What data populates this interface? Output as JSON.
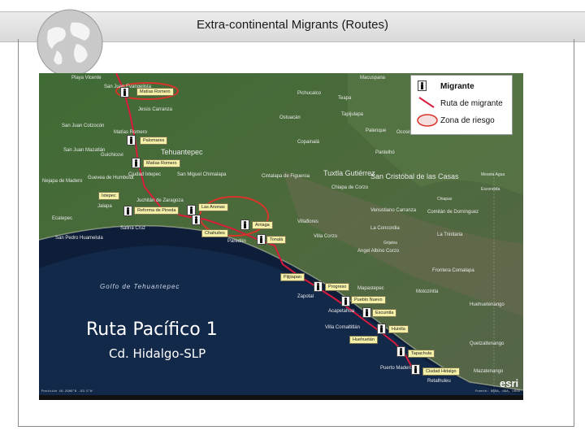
{
  "slide": {
    "title": "Extra-continental Migrants (Routes)"
  },
  "legend": {
    "migrant": "Migrante",
    "route": "Ruta de migrante",
    "risk_zone": "Zona de riesgo"
  },
  "map": {
    "route_title": "Ruta Pacífico 1",
    "route_subtitle": "Cd. Hidalgo-SLP",
    "gulf": "Golfo de Tehuantepec",
    "attribution": "esri",
    "route_labels": {
      "matias_romero_top": "Matías Romero",
      "palomares": "Palomares",
      "matias_romero": "Matías Romero",
      "ixtepec": "Ixtepec",
      "reforma": "Reforma de Pineda",
      "las_anonas": "Las Anonas",
      "arriaga": "Arriaga",
      "chahuites": "Chahuites",
      "tonala": "Tonalá",
      "pijijiapan": "Pijijiapan",
      "progreso": "Progreso",
      "pueblo_nuevo": "Pueblo Nuevo",
      "escuintla": "Escuintla",
      "huixtla": "Huixtla",
      "huehuetan": "Huehuetán",
      "tapachula": "Tapachula",
      "ciudad_hidalgo": "Ciudad Hidalgo"
    },
    "places": {
      "playa_vicente": "Playa Vicente",
      "san_juan_evangelista": "San Juan Evangelista",
      "jesus_carranza": "Jesús Carranza",
      "macuspana": "Macuspana",
      "teapa": "Teapa",
      "pichucalco": "Pichucalco",
      "tapijulapa": "Tapijulapa",
      "ostuacan": "Ostuacán",
      "copainala": "Copainalá",
      "pantelho": "Pantelhó",
      "palenque": "Palenque",
      "ocosingo": "Ocosingo",
      "sanjuan_cotzocon": "San Juan Cotzocón",
      "san_juan_mazatlan": "San Juan Mazatlán",
      "matias_romero_map": "Matías Romero",
      "guichicovi": "Guichicovi",
      "tehuantepec": "Tehuantepec",
      "nejapa": "Nejapa de Madero",
      "guevea": "Guevea de Humboldt",
      "ciudad_ixtepec": "Ciudad Ixtepec",
      "juchitan": "Juchitán de Zaragoza",
      "jalapa": "Jalapa",
      "san_miguel_chimalapa": "San Miguel Chimalapa",
      "cintalapa": "Cintalapa de Figueroa",
      "tuxtla": "Tuxtla Gutiérrez",
      "chiapa": "Chiapa de Corzo",
      "san_cristobal": "San Cristóbal de las Casas",
      "villaflores": "Villaflores",
      "villa_corzo": "Villa Corzo",
      "venustiano": "Venustiano Carranza",
      "la_concordia": "La Concordia",
      "comitan": "Comitán de Domínguez",
      "la_trinitaria": "La Trinitaria",
      "salina_cruz": "Salina Cruz",
      "ecatepec": "Ecatepec",
      "san_pedro_huamelula": "San Pedro Huamelula",
      "tonala_map": "Tonalá",
      "paredon": "Paredón",
      "angel_albino": "Angel Albino Corzo",
      "frontera_comalapa": "Frontera Comalapa",
      "motozintla": "Motozintla",
      "mapastepec": "Mapastepec",
      "acapetahua": "Acapetahua",
      "villa_comaltitlan": "Villa Comaltitlán",
      "huehuetenango": "Huehuetenango",
      "quetzaltenango": "Quetzaltenango",
      "retalhuleu": "Retalhuleu",
      "puerto_madero": "Puerto Madero",
      "mazatenango": "Mazatenango",
      "zapotal": "Zapotal",
      "grijalva": "Grijalva",
      "chiapas": "Chiapas",
      "escondida": "Escondida",
      "meseta_agua": "Meseta Agua"
    },
    "status_left": "Posición 16.2966°N -93.5°W",
    "status_right": "Fuente: NASA, NGA, USGS"
  },
  "colors": {
    "route": "#d81b3c",
    "risk_zone": "#d8352a",
    "route_label_bg": "#f4f0a8"
  }
}
